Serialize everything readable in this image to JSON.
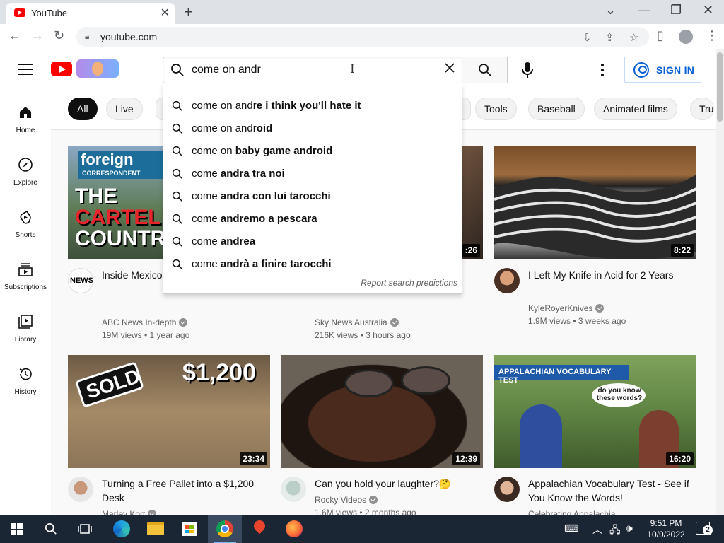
{
  "browser": {
    "tab_title": "YouTube",
    "tab_close": "✕",
    "new_tab": "+",
    "url": "youtube.com",
    "window_controls": {
      "chevron": "⌄",
      "minimize": "—",
      "restore": "❐",
      "close": "✕"
    }
  },
  "header": {
    "search_value": "come on andr",
    "signin_label": "SIGN IN"
  },
  "chips": [
    "All",
    "Live",
    "Tools",
    "Baseball",
    "Animated films",
    "Tru"
  ],
  "sidebar": [
    {
      "label": "Home",
      "icon": "home-icon"
    },
    {
      "label": "Explore",
      "icon": "compass-icon"
    },
    {
      "label": "Shorts",
      "icon": "shorts-icon"
    },
    {
      "label": "Subscriptions",
      "icon": "subscriptions-icon"
    },
    {
      "label": "Library",
      "icon": "library-icon"
    },
    {
      "label": "History",
      "icon": "history-icon"
    }
  ],
  "suggestions": [
    {
      "prefix": "come on andr",
      "rest": "e i think you'll hate it"
    },
    {
      "prefix": "come on andr",
      "rest": "oid"
    },
    {
      "prefix": "come on ",
      "rest": "baby game android"
    },
    {
      "prefix": "come ",
      "rest": "andra tra noi"
    },
    {
      "prefix": "come ",
      "rest": "andra con lui tarocchi"
    },
    {
      "prefix": "come ",
      "rest": "andremo a pescara"
    },
    {
      "prefix": "come ",
      "rest": "andrea"
    },
    {
      "prefix": "come ",
      "rest": "andrà a finire tarocchi"
    }
  ],
  "report_label": "Report search predictions",
  "videos": [
    {
      "title": "Inside Mexico's Drug Cartel | F",
      "channel": "ABC News In-depth",
      "meta": "19M views • 1 year ago",
      "duration": "",
      "thumb_text": {
        "badge": "foreign",
        "badge_sub": "CORRESPONDENT",
        "line1": "THE",
        "line2": "CARTEL",
        "line3": "COUNTR"
      },
      "avatar_text": "NEWS"
    },
    {
      "title": "",
      "channel": "Sky News Australia",
      "meta": "216K views • 3 hours ago",
      "duration": ":26"
    },
    {
      "title": "I Left My Knife in Acid for 2 Years",
      "channel": "KyleRoyerKnives",
      "meta": "1.9M views • 3 weeks ago",
      "duration": "8:22"
    },
    {
      "title": "Turning a Free Pallet into a $1,200 Desk",
      "channel": "Marley Kort",
      "meta": "",
      "duration": "23:34",
      "thumb_text": {
        "sold": "SOLD",
        "price": "$1,200"
      }
    },
    {
      "title": "Can you hold your laughter?🤔",
      "channel": "Rocky Videos",
      "meta": "1.6M views • 2 months ago",
      "duration": "12:39"
    },
    {
      "title": "Appalachian Vocabulary Test - See if You Know the Words!",
      "channel": "Celebrating Appalachia",
      "meta": "",
      "duration": "16:20",
      "thumb_text": {
        "banner": "APPALACHIAN VOCABULARY TEST",
        "bubble": "do you know these words?"
      }
    }
  ],
  "taskbar": {
    "time": "9:51 PM",
    "date": "10/9/2022",
    "notifications": "2"
  }
}
